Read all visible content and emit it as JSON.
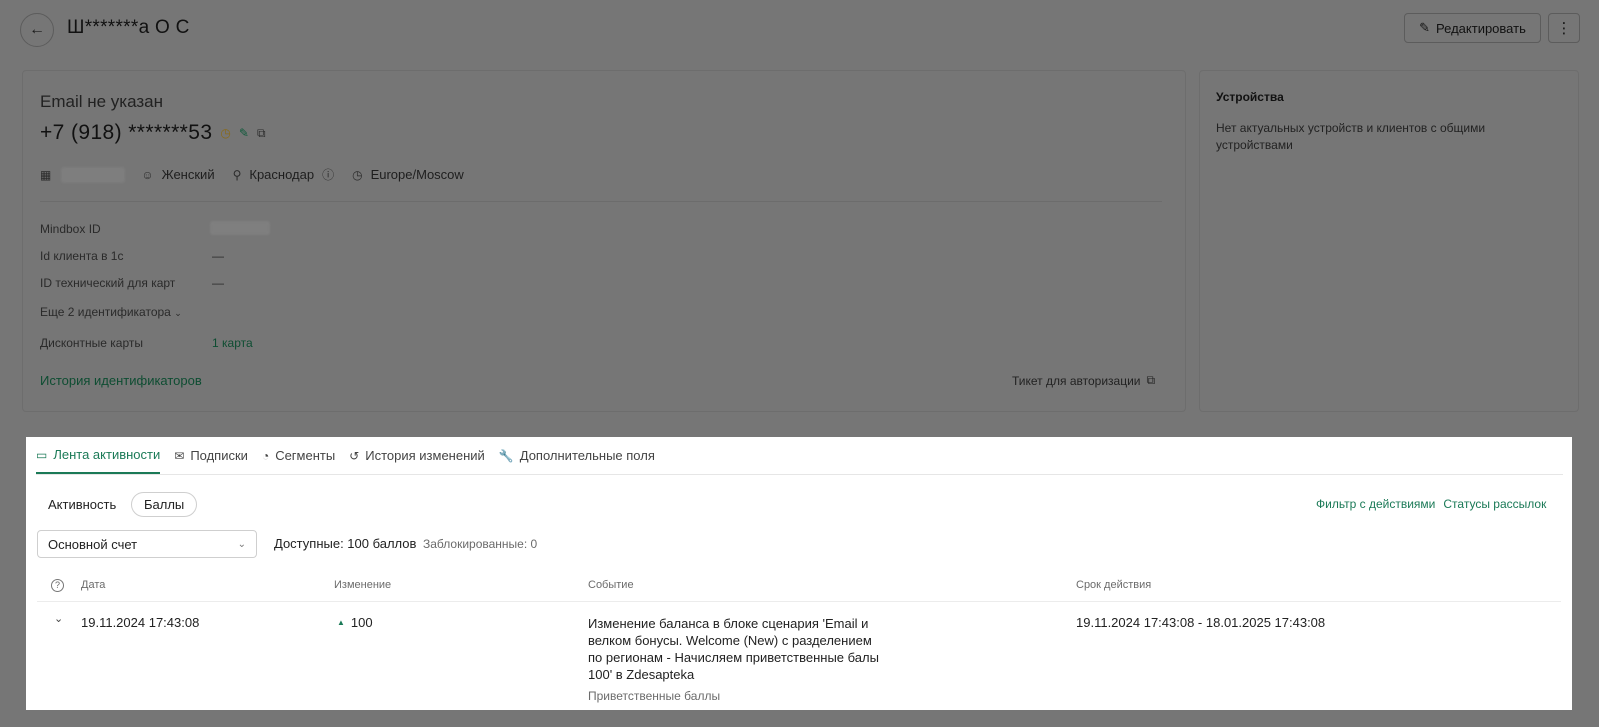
{
  "header": {
    "back_icon": "arrow-left-icon",
    "title": "Ш*******а О С",
    "edit_label": "Редактировать",
    "edit_icon": "pencil-icon",
    "more_icon": "kebab-menu-icon"
  },
  "profile": {
    "email": "Email не указан",
    "phone": "+7 (918) *******53",
    "gender": "Женский",
    "city": "Краснодар",
    "timezone": "Europe/Moscow",
    "ids": [
      {
        "label": "Mindbox ID",
        "value": ""
      },
      {
        "label": "Id клиента в 1с",
        "value": "—"
      },
      {
        "label": "ID технический для карт",
        "value": "—"
      }
    ],
    "more_ids": "Еще 2 идентификатора",
    "discount_label": "Дисконтные карты",
    "discount_value": "1 карта",
    "history_link": "История идентификаторов",
    "ticket_label": "Тикет для авторизации"
  },
  "devices": {
    "title": "Устройства",
    "text": "Нет актуальных устройств и клиентов с общими устройствами"
  },
  "tabs": [
    {
      "label": "Лента активности",
      "icon": "monitor-icon",
      "active": true
    },
    {
      "label": "Подписки",
      "icon": "mail-icon",
      "active": false
    },
    {
      "label": "Сегменты",
      "icon": "pie-icon",
      "active": false
    },
    {
      "label": "История изменений",
      "icon": "history-icon",
      "active": false
    },
    {
      "label": "Дополнительные поля",
      "icon": "wrench-icon",
      "active": false
    }
  ],
  "subtabs": {
    "activity": "Активность",
    "points": "Баллы"
  },
  "links": {
    "filter": "Фильтр с действиями",
    "statuses": "Статусы рассылок"
  },
  "account": {
    "selected": "Основной счет",
    "available": "Доступные: 100 баллов",
    "blocked": "Заблокированные: 0"
  },
  "table": {
    "headers": [
      "Дата",
      "Изменение",
      "Событие",
      "Срок действия"
    ],
    "rows": [
      {
        "date": "19.11.2024 17:43:08",
        "change": "100",
        "event": "Изменение баланса в блоке сценария 'Email и велком бонусы. Welcome (New) с разделением по регионам - Начисляем приветственные балы 100' в Zdesapteka",
        "event_type": "Приветственные баллы",
        "validity": "19.11.2024 17:43:08 - 18.01.2025 17:43:08"
      }
    ]
  }
}
